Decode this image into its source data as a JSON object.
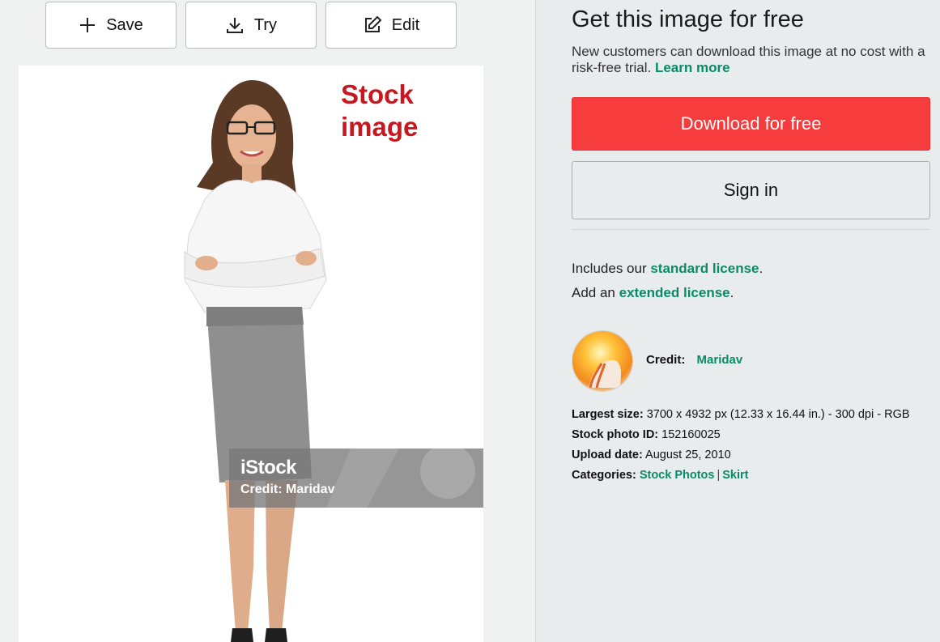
{
  "toolbar": {
    "save_label": "Save",
    "try_label": "Try",
    "edit_label": "Edit"
  },
  "image": {
    "overlay_label_line1": "Stock",
    "overlay_label_line2": "image",
    "watermark_logo": "iStock",
    "watermark_credit": "Credit: Maridav"
  },
  "panel": {
    "title": "Get this image for free",
    "subtitle": "New customers can download this image at no cost with a risk-free trial.",
    "learn_more": "Learn more",
    "download_button": "Download for free",
    "signin_button": "Sign in",
    "license_prefix": "Includes our ",
    "standard_license": "standard license",
    "license_suffix": ".",
    "extended_prefix": "Add an ",
    "extended_license": "extended license",
    "extended_suffix": ".",
    "credit_label": "Credit:",
    "credit_name": "Maridav",
    "largest_size_label": "Largest size:",
    "largest_size_value": "3700 x 4932 px (12.33 x 16.44 in.) - 300 dpi - RGB",
    "photo_id_label": "Stock photo ID:",
    "photo_id_value": "152160025",
    "upload_date_label": "Upload date:",
    "upload_date_value": "August 25, 2010",
    "categories_label": "Categories:",
    "category_1": "Stock Photos",
    "category_sep": "|",
    "category_2": "Skirt"
  },
  "colors": {
    "accent_link": "#0b8a6a",
    "download_red": "#f73c3e",
    "stock_label_red": "#c8171e"
  },
  "icons": [
    "plus-icon",
    "download-icon",
    "edit-icon"
  ]
}
